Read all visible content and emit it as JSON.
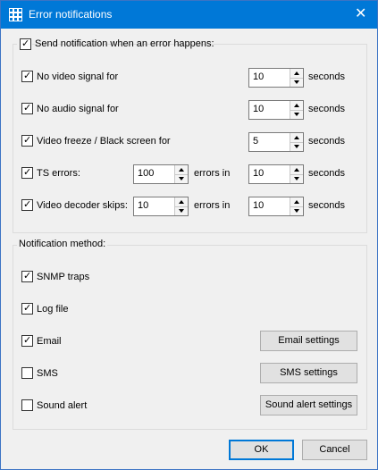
{
  "window": {
    "title": "Error notifications",
    "close_glyph": "✕",
    "icon": "grid-icon"
  },
  "conditions": {
    "master_label": "Send notification when an error happens:",
    "master_checked": true,
    "rows": [
      {
        "label": "No video signal for",
        "checked": true,
        "value": "10",
        "unit": "seconds"
      },
      {
        "label": "No audio signal for",
        "checked": true,
        "value": "10",
        "unit": "seconds"
      },
      {
        "label": "Video freeze / Black screen for",
        "checked": true,
        "value": "5",
        "unit": "seconds"
      },
      {
        "label": "TS errors:",
        "checked": true,
        "count": "100",
        "mid": "errors in",
        "value": "10",
        "unit": "seconds"
      },
      {
        "label": "Video decoder skips:",
        "checked": true,
        "count": "10",
        "mid": "errors in",
        "value": "10",
        "unit": "seconds"
      }
    ]
  },
  "method": {
    "legend": "Notification method:",
    "items": [
      {
        "label": "SNMP traps",
        "checked": true
      },
      {
        "label": "Log file",
        "checked": true
      },
      {
        "label": "Email",
        "checked": true,
        "button": "Email settings"
      },
      {
        "label": "SMS",
        "checked": false,
        "button": "SMS settings"
      },
      {
        "label": "Sound alert",
        "checked": false,
        "button": "Sound alert settings"
      }
    ]
  },
  "footer": {
    "ok": "OK",
    "cancel": "Cancel"
  },
  "colors": {
    "titlebar": "#0078d7",
    "background": "#f0f0f0",
    "accent": "#0078d7"
  }
}
